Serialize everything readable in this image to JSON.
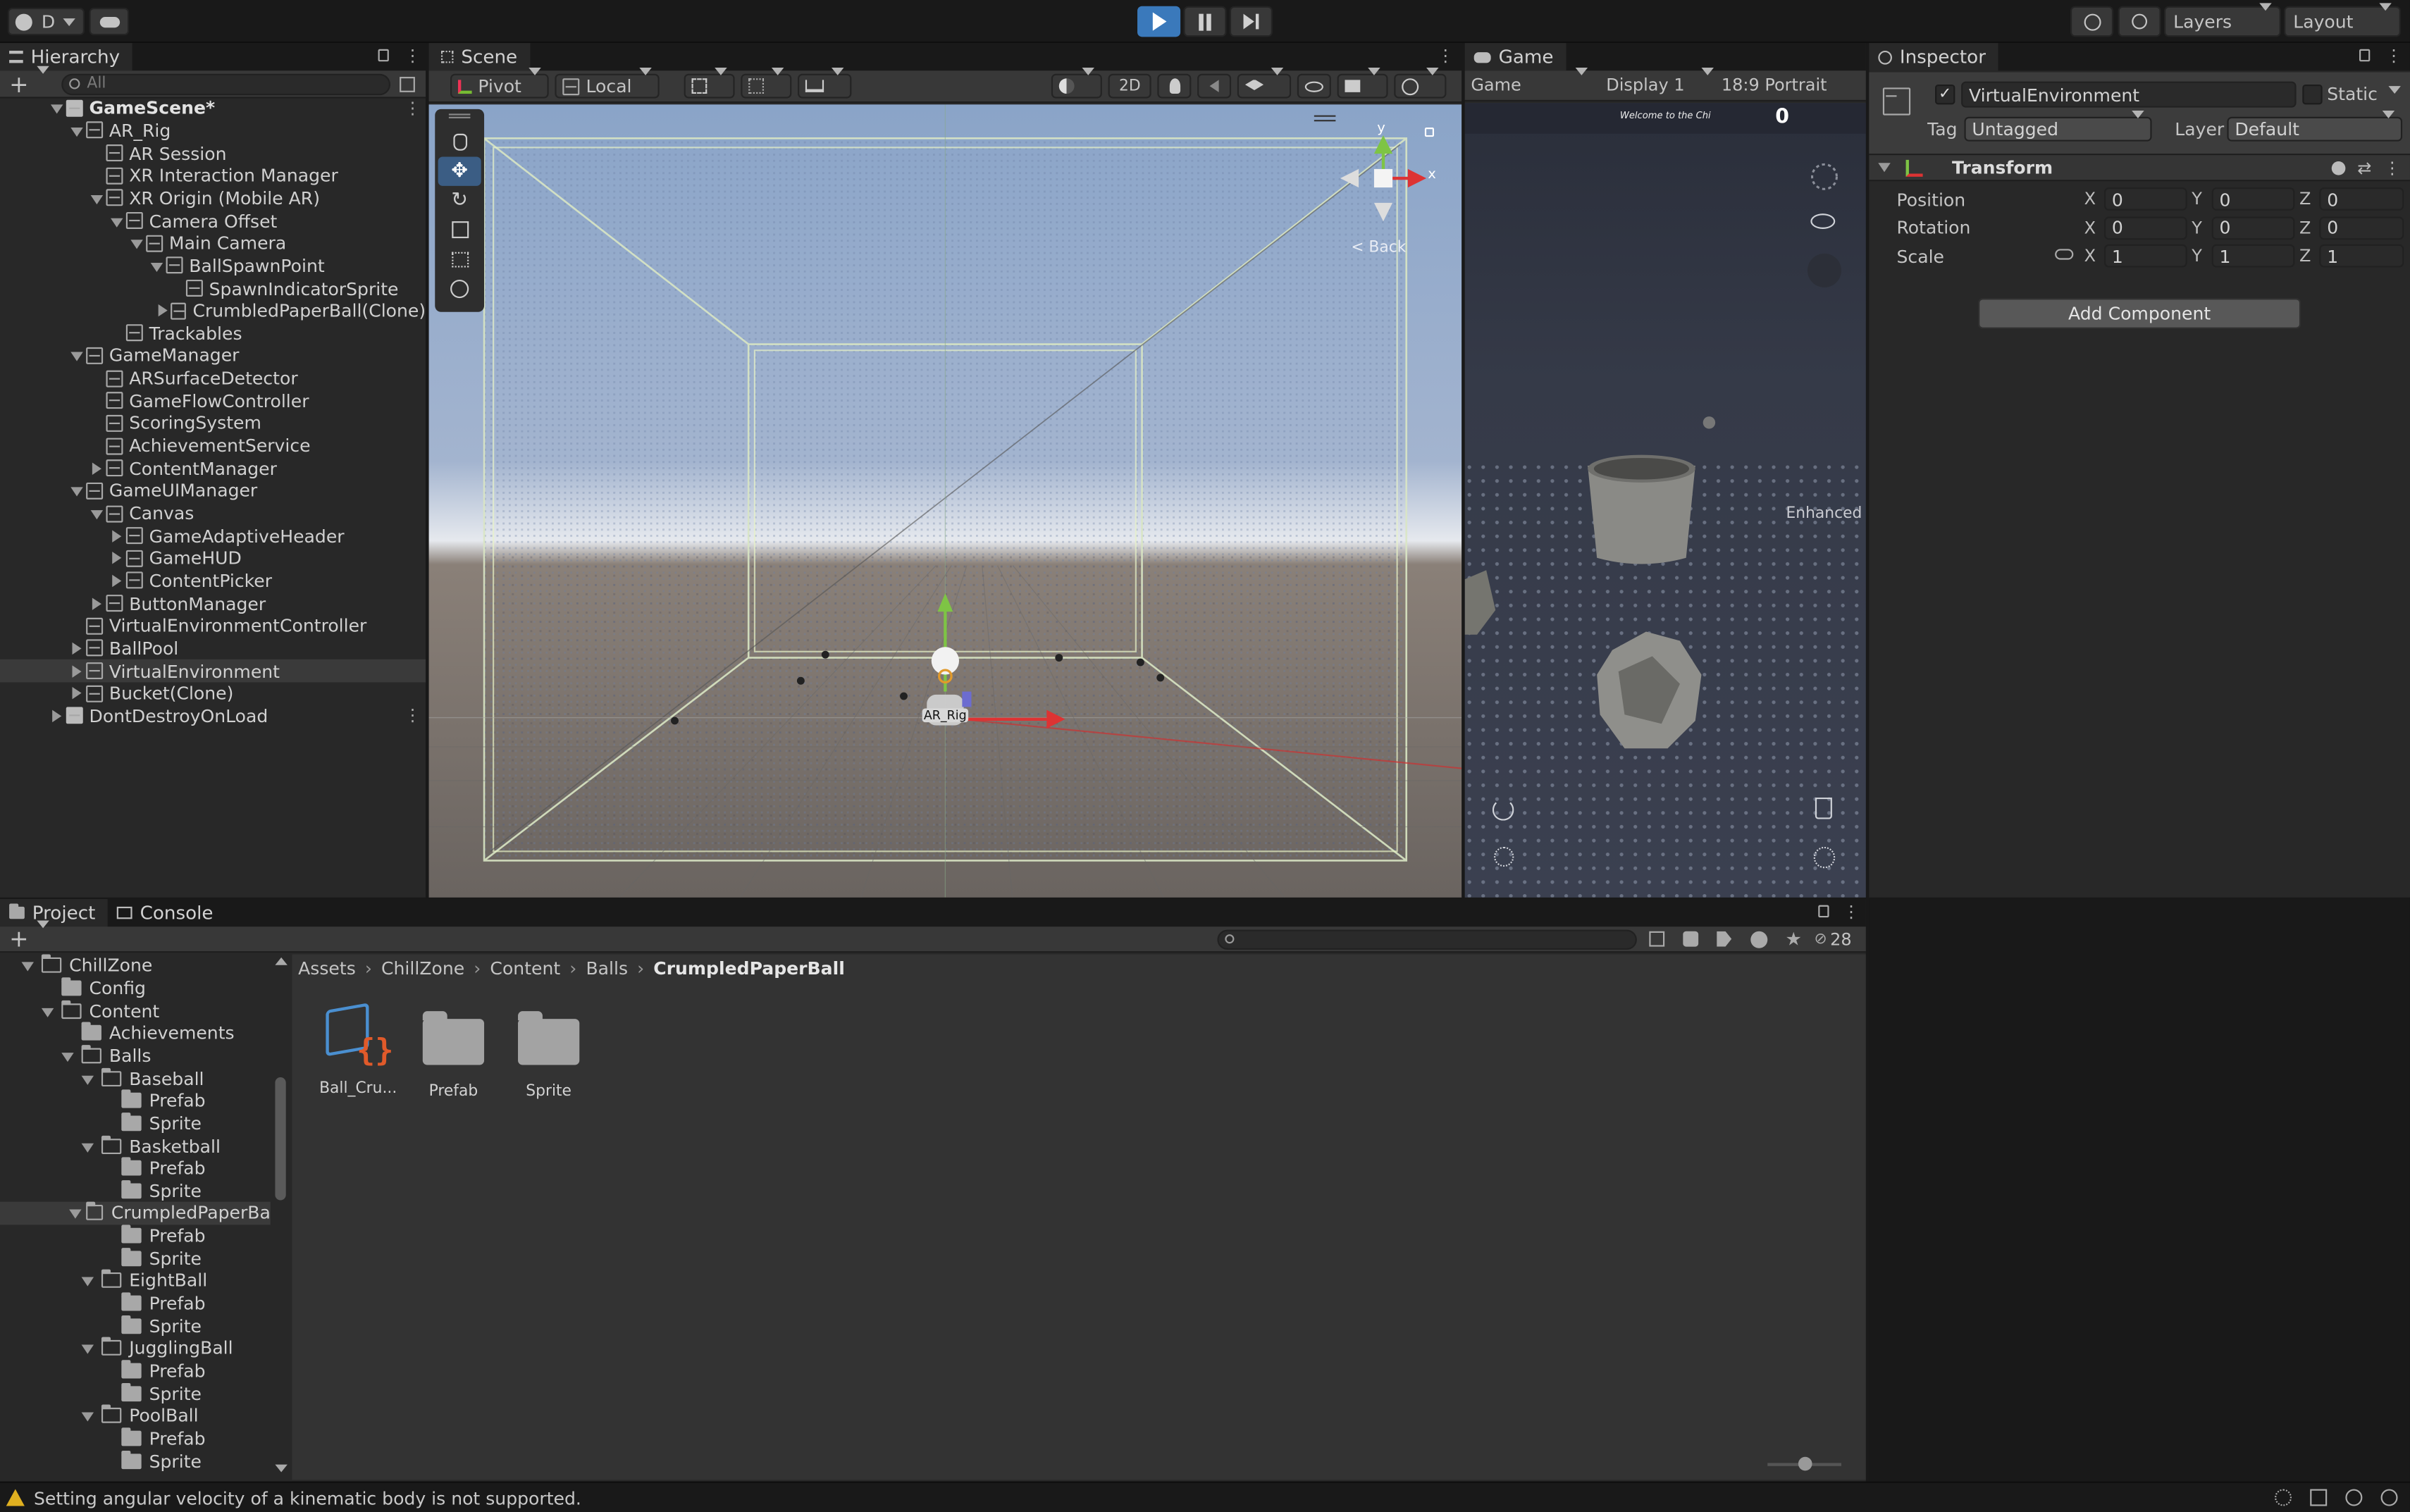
{
  "toolbar": {
    "account_label": "D",
    "cloud_icon": "cloud-icon",
    "play_icon": "play-icon",
    "pause_icon": "pause-icon",
    "step_icon": "step-icon",
    "layers_label": "Layers",
    "layout_label": "Layout",
    "accent": "#3a79bb"
  },
  "hierarchy": {
    "tab_label": "Hierarchy",
    "search_placeholder": "All",
    "items": [
      {
        "label": "GameScene*",
        "depth": 0,
        "state": "open",
        "kind": "scene"
      },
      {
        "label": "AR_Rig",
        "depth": 1,
        "state": "open",
        "kind": "cube"
      },
      {
        "label": "AR Session",
        "depth": 2,
        "state": "none",
        "kind": "cube"
      },
      {
        "label": "XR Interaction Manager",
        "depth": 2,
        "state": "none",
        "kind": "cube"
      },
      {
        "label": "XR Origin (Mobile AR)",
        "depth": 2,
        "state": "open",
        "kind": "cube"
      },
      {
        "label": "Camera Offset",
        "depth": 3,
        "state": "open",
        "kind": "cube"
      },
      {
        "label": "Main Camera",
        "depth": 4,
        "state": "open",
        "kind": "cube"
      },
      {
        "label": "BallSpawnPoint",
        "depth": 5,
        "state": "open",
        "kind": "cube"
      },
      {
        "label": "SpawnIndicatorSprite",
        "depth": 6,
        "state": "none",
        "kind": "cube"
      },
      {
        "label": "CrumbledPaperBall(Clone)",
        "depth": 6,
        "state": "closed",
        "kind": "cube"
      },
      {
        "label": "Trackables",
        "depth": 3,
        "state": "none",
        "kind": "cube"
      },
      {
        "label": "GameManager",
        "depth": 1,
        "state": "open",
        "kind": "cube"
      },
      {
        "label": "ARSurfaceDetector",
        "depth": 2,
        "state": "none",
        "kind": "cube"
      },
      {
        "label": "GameFlowController",
        "depth": 2,
        "state": "none",
        "kind": "cube"
      },
      {
        "label": "ScoringSystem",
        "depth": 2,
        "state": "none",
        "kind": "cube"
      },
      {
        "label": "AchievementService",
        "depth": 2,
        "state": "none",
        "kind": "cube"
      },
      {
        "label": "ContentManager",
        "depth": 2,
        "state": "closed",
        "kind": "cube"
      },
      {
        "label": "GameUIManager",
        "depth": 1,
        "state": "open",
        "kind": "cube"
      },
      {
        "label": "Canvas",
        "depth": 2,
        "state": "open",
        "kind": "cube"
      },
      {
        "label": "GameAdaptiveHeader",
        "depth": 3,
        "state": "closed",
        "kind": "cube"
      },
      {
        "label": "GameHUD",
        "depth": 3,
        "state": "closed",
        "kind": "cube"
      },
      {
        "label": "ContentPicker",
        "depth": 3,
        "state": "closed",
        "kind": "cube"
      },
      {
        "label": "ButtonManager",
        "depth": 2,
        "state": "closed",
        "kind": "cube"
      },
      {
        "label": "VirtualEnvironmentController",
        "depth": 1,
        "state": "none",
        "kind": "cube"
      },
      {
        "label": "BallPool",
        "depth": 1,
        "state": "closed",
        "kind": "cube"
      },
      {
        "label": "VirtualEnvironment",
        "depth": 1,
        "state": "closed",
        "kind": "cube",
        "selected": true
      },
      {
        "label": "Bucket(Clone)",
        "depth": 1,
        "state": "closed",
        "kind": "cube"
      },
      {
        "label": "DontDestroyOnLoad",
        "depth": 0,
        "state": "closed",
        "kind": "scene"
      }
    ]
  },
  "scene": {
    "tab_label": "Scene",
    "pivot_label": "Pivot",
    "local_label": "Local",
    "mode_2d_label": "2D",
    "gizmo_y": "y",
    "gizmo_x": "x",
    "back_label": "< Back",
    "rig_label": "AR_Rig"
  },
  "game": {
    "tab_label": "Game",
    "mode_label": "Game",
    "display_label": "Display 1",
    "aspect_label": "18:9 Portrait",
    "welcome_text": "Welcome to the Chi",
    "score_value": "0",
    "enhanced_text": "Enhanced"
  },
  "inspector": {
    "tab_label": "Inspector",
    "object_name": "VirtualEnvironment",
    "static_label": "Static",
    "tag_label": "Tag",
    "tag_value": "Untagged",
    "layer_label": "Layer",
    "layer_value": "Default",
    "component_title": "Transform",
    "rows": [
      {
        "label": "Position",
        "x": "0",
        "y": "0",
        "z": "0"
      },
      {
        "label": "Rotation",
        "x": "0",
        "y": "0",
        "z": "0"
      },
      {
        "label": "Scale",
        "x": "1",
        "y": "1",
        "z": "1"
      }
    ],
    "axis_x": "X",
    "axis_y": "Y",
    "axis_z": "Z",
    "add_component_label": "Add Component"
  },
  "project": {
    "tab_project": "Project",
    "tab_console": "Console",
    "hidden_count": "28",
    "breadcrumb": [
      "Assets",
      "ChillZone",
      "Content",
      "Balls",
      "CrumpledPaperBall"
    ],
    "tree": [
      {
        "label": "ChillZone",
        "depth": 0,
        "state": "open"
      },
      {
        "label": "Config",
        "depth": 1,
        "state": "none"
      },
      {
        "label": "Content",
        "depth": 1,
        "state": "open"
      },
      {
        "label": "Achievements",
        "depth": 2,
        "state": "none"
      },
      {
        "label": "Balls",
        "depth": 2,
        "state": "open"
      },
      {
        "label": "Baseball",
        "depth": 3,
        "state": "open"
      },
      {
        "label": "Prefab",
        "depth": 4,
        "state": "none"
      },
      {
        "label": "Sprite",
        "depth": 4,
        "state": "none"
      },
      {
        "label": "Basketball",
        "depth": 3,
        "state": "open"
      },
      {
        "label": "Prefab",
        "depth": 4,
        "state": "none"
      },
      {
        "label": "Sprite",
        "depth": 4,
        "state": "none"
      },
      {
        "label": "CrumpledPaperBa",
        "depth": 3,
        "state": "open",
        "selected": true
      },
      {
        "label": "Prefab",
        "depth": 4,
        "state": "none"
      },
      {
        "label": "Sprite",
        "depth": 4,
        "state": "none"
      },
      {
        "label": "EightBall",
        "depth": 3,
        "state": "open"
      },
      {
        "label": "Prefab",
        "depth": 4,
        "state": "none"
      },
      {
        "label": "Sprite",
        "depth": 4,
        "state": "none"
      },
      {
        "label": "JugglingBall",
        "depth": 3,
        "state": "open"
      },
      {
        "label": "Prefab",
        "depth": 4,
        "state": "none"
      },
      {
        "label": "Sprite",
        "depth": 4,
        "state": "none"
      },
      {
        "label": "PoolBall",
        "depth": 3,
        "state": "open"
      },
      {
        "label": "Prefab",
        "depth": 4,
        "state": "none"
      },
      {
        "label": "Sprite",
        "depth": 4,
        "state": "none"
      }
    ],
    "assets": [
      {
        "label": "Ball_Cru...",
        "kind": "script-object"
      },
      {
        "label": "Prefab",
        "kind": "folder"
      },
      {
        "label": "Sprite",
        "kind": "folder"
      }
    ]
  },
  "status": {
    "message": "Setting angular velocity of a kinematic body is not supported.",
    "warning_color": "#e0b020"
  }
}
